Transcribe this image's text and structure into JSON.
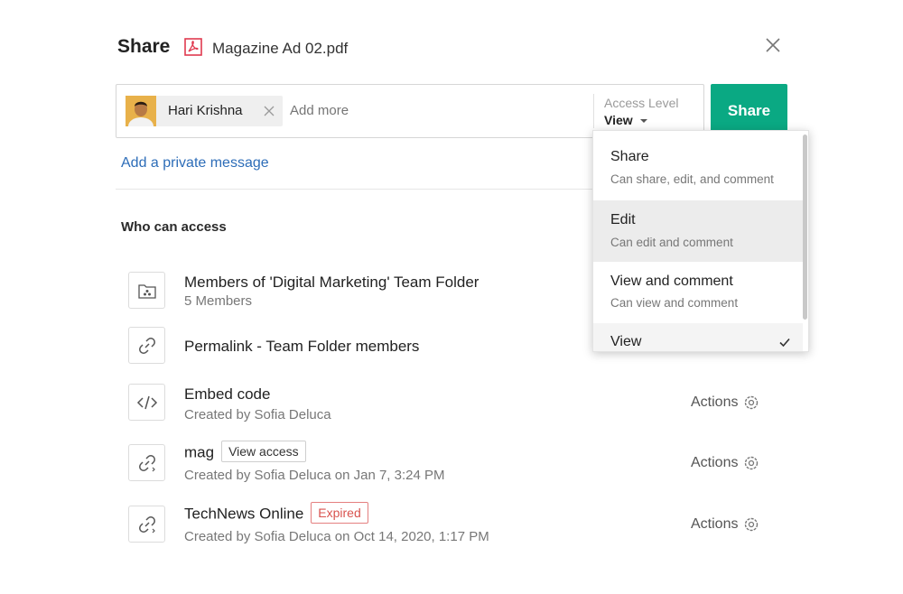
{
  "header": {
    "title": "Share",
    "file_name": "Magazine Ad 02.pdf",
    "file_icon": "pdf-icon",
    "close_icon": "close-icon"
  },
  "share_box": {
    "recipient": {
      "name": "Hari Krishna",
      "avatar": "avatar-photo",
      "remove_icon": "close-icon"
    },
    "add_more_placeholder": "Add more",
    "access_level": {
      "label": "Access Level",
      "value": "View"
    },
    "share_button": "Share"
  },
  "private_message_link": "Add a private message",
  "who_can_access": {
    "title": "Who can access",
    "items": [
      {
        "icon": "team-folder-icon",
        "title": "Members of 'Digital Marketing' Team Folder",
        "subtitle": "5 Members"
      },
      {
        "icon": "link-icon",
        "title": "Permalink - Team Folder members"
      },
      {
        "icon": "embed-code-icon",
        "title": "Embed code",
        "subtitle": "Created by Sofia Deluca",
        "actions": "Actions"
      },
      {
        "icon": "shared-link-icon",
        "title": "mag",
        "tag": "View access",
        "subtitle": "Created by Sofia Deluca on Jan 7, 3:24 PM",
        "actions": "Actions"
      },
      {
        "icon": "shared-link-icon",
        "title": "TechNews Online",
        "tag": "Expired",
        "subtitle": "Created by Sofia Deluca on Oct 14, 2020, 1:17 PM",
        "actions": "Actions"
      }
    ]
  },
  "access_dropdown": {
    "options": [
      {
        "label": "Share",
        "description": "Can share, edit, and comment"
      },
      {
        "label": "Edit",
        "description": "Can edit and comment",
        "highlighted": true
      },
      {
        "label": "View and comment",
        "description": "Can view and comment"
      },
      {
        "label": "View",
        "selected": true
      }
    ]
  },
  "colors": {
    "share_button": "#0aa983",
    "link": "#2d6db8",
    "expired": "#d9534f"
  }
}
